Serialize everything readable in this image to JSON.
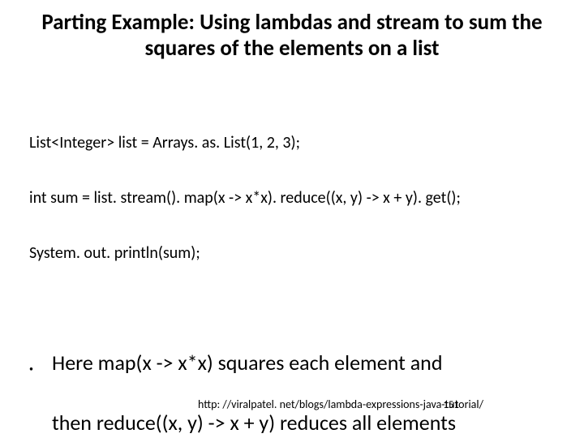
{
  "title": "Parting Example: Using lambdas and stream to sum the squares of the elements on a list",
  "code": {
    "line1": "List<Integer> list = Arrays. as. List(1, 2, 3);",
    "line2": "int sum = list. stream(). map(x -> x*x). reduce((x, y) -> x + y). get();",
    "line3": "System. out. println(sum);"
  },
  "bullet": {
    "line1": "Here map(x -> x*x) squares each element and",
    "line2": "then reduce((x, y) -> x + y) reduces all elements"
  },
  "url": "http: //viralpatel. net/blogs/lambda-expressions-java-tutorial/",
  "page_number": "151"
}
